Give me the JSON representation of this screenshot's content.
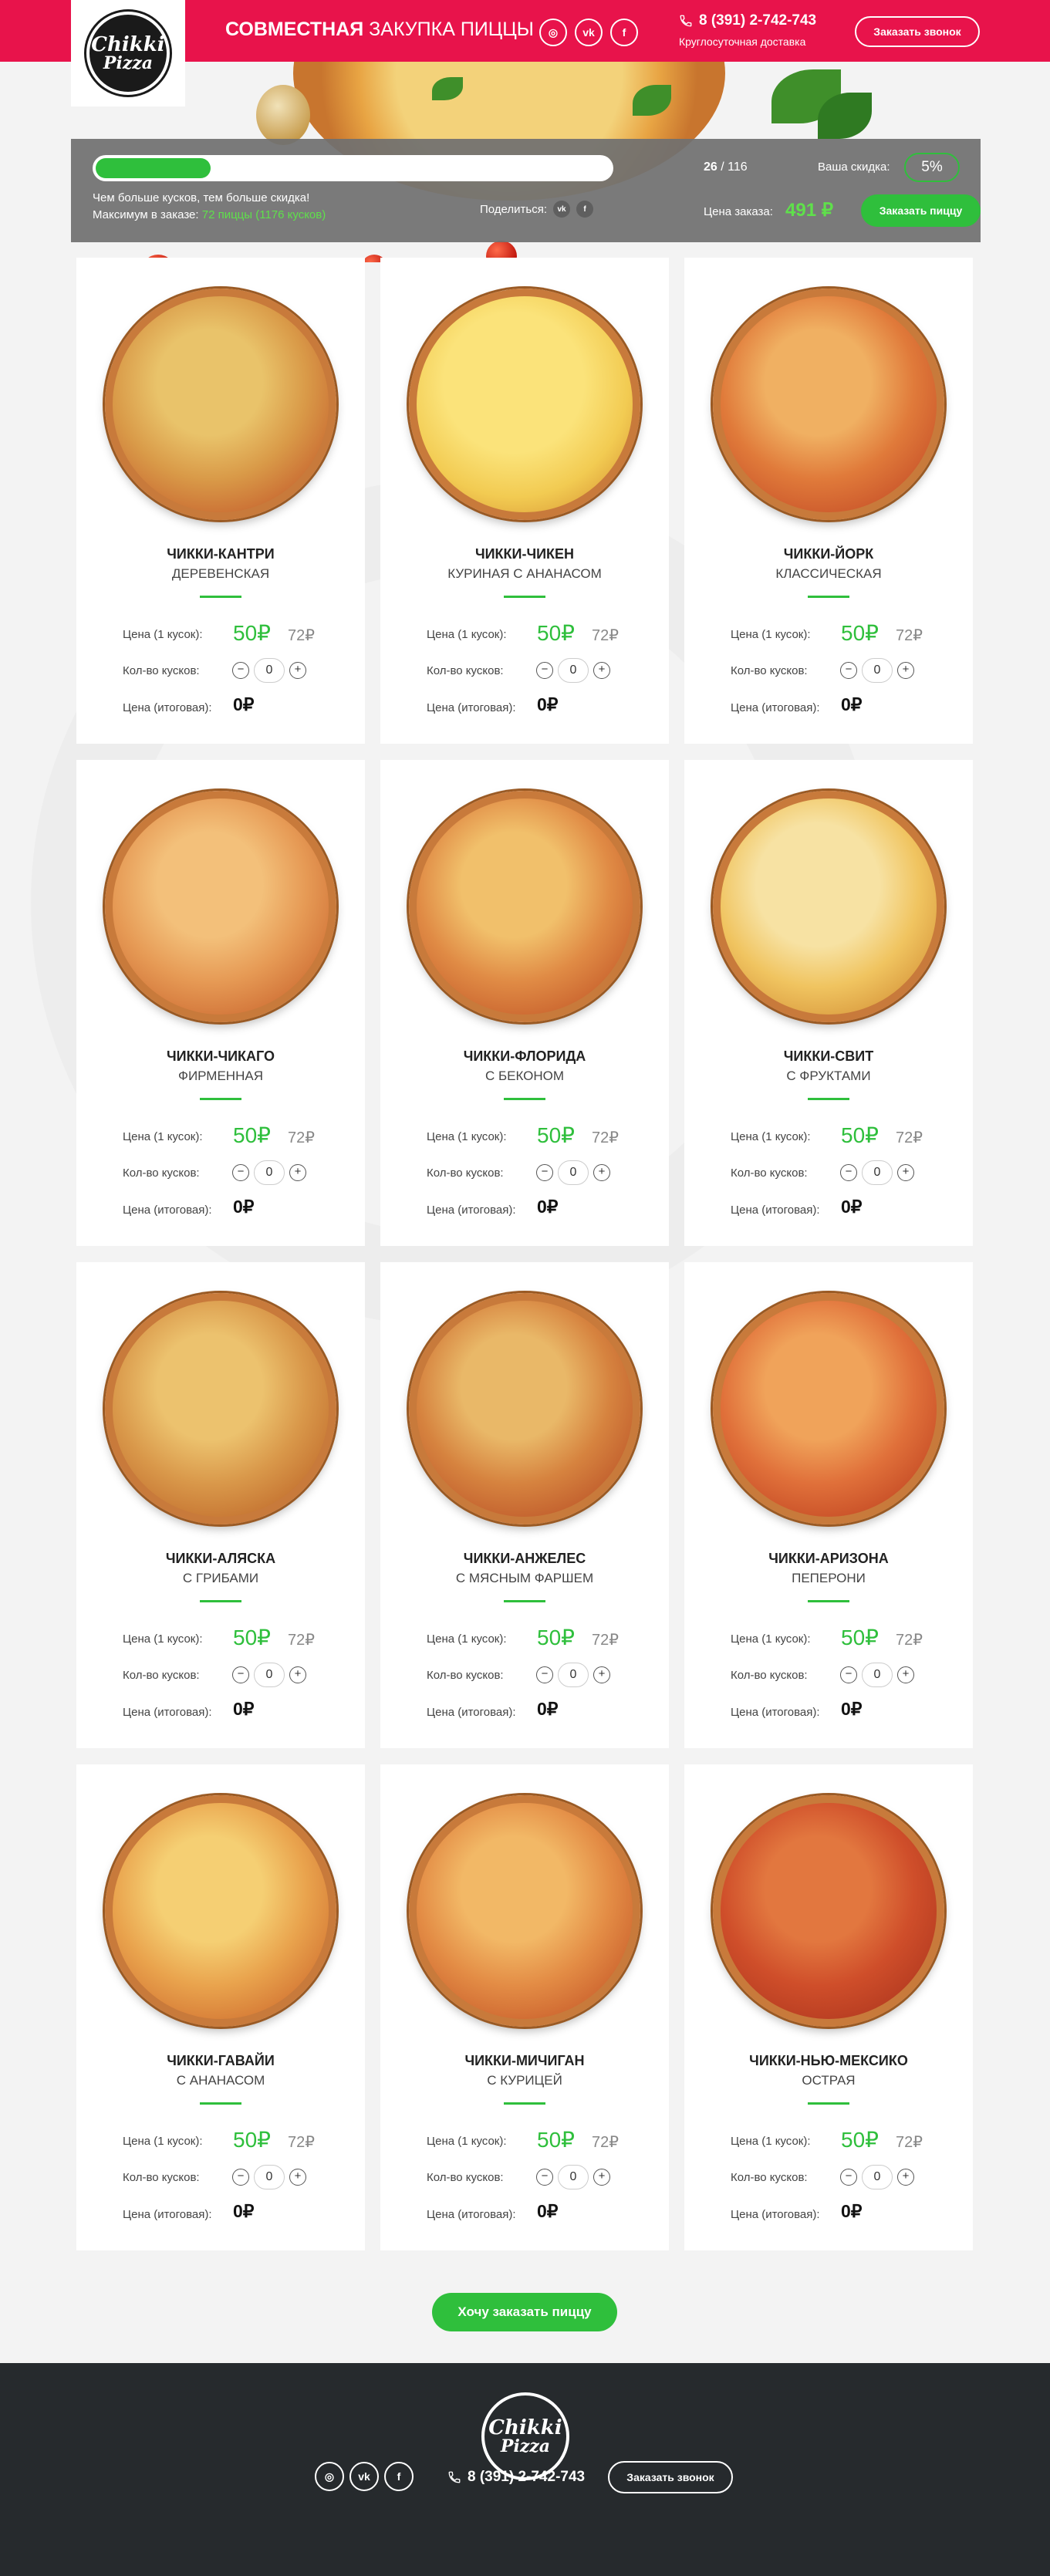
{
  "header": {
    "logo_line1": "Chikki",
    "logo_line2": "Pizza",
    "title_bold": "СОВМЕСТНАЯ",
    "title_rest": "ЗАКУПКА ПИЦЦЫ",
    "phone": "8 (391) 2-742-743",
    "delivery_text": "Круглосуточная доставка",
    "call_button": "Заказать звонок",
    "social": [
      "instagram-icon",
      "vk-icon",
      "facebook-icon"
    ],
    "social_glyphs": {
      "instagram": "◎",
      "vk": "vk",
      "facebook": "f"
    }
  },
  "promo": {
    "progress_fraction": 0.224,
    "text_line1": "Чем больше кусков, тем больше скидка!",
    "text_line2_prefix": "Максимум в заказе:",
    "text_line2_value": "72 пиццы (1176 кусков)",
    "share_label": "Поделиться:",
    "count_current": "26",
    "count_separator": " / ",
    "count_total": "116",
    "discount_label": "Ваша скидка:",
    "discount_value": "5%",
    "total_label": "Цена заказа:",
    "total_value": "491 ₽",
    "order_button": "Заказать пиццу"
  },
  "labels": {
    "price_piece": "Цена (1 кусок):",
    "quantity": "Кол-во кусков:",
    "final_price": "Цена (итоговая):",
    "minus": "−",
    "plus": "+"
  },
  "colors": {
    "brand_red": "#e8134b",
    "accent_green": "#2fbf3c",
    "footer_dark": "#262a2d"
  },
  "pizzas": [
    {
      "name": "ЧИККИ-КАНТРИ",
      "subtitle": "ДЕРЕВЕНСКАЯ",
      "price": "50₽",
      "old_price": "72₽",
      "quantity": "0",
      "final": "0₽"
    },
    {
      "name": "ЧИККИ-ЧИКЕН",
      "subtitle": "КУРИНАЯ С АНАНАСОМ",
      "price": "50₽",
      "old_price": "72₽",
      "quantity": "0",
      "final": "0₽"
    },
    {
      "name": "ЧИККИ-ЙОРК",
      "subtitle": "КЛАССИЧЕСКАЯ",
      "price": "50₽",
      "old_price": "72₽",
      "quantity": "0",
      "final": "0₽"
    },
    {
      "name": "ЧИККИ-ЧИКАГО",
      "subtitle": "ФИРМЕННАЯ",
      "price": "50₽",
      "old_price": "72₽",
      "quantity": "0",
      "final": "0₽"
    },
    {
      "name": "ЧИККИ-ФЛОРИДА",
      "subtitle": "С БЕКОНОМ",
      "price": "50₽",
      "old_price": "72₽",
      "quantity": "0",
      "final": "0₽"
    },
    {
      "name": "ЧИККИ-СВИТ",
      "subtitle": "С ФРУКТАМИ",
      "price": "50₽",
      "old_price": "72₽",
      "quantity": "0",
      "final": "0₽"
    },
    {
      "name": "ЧИККИ-АЛЯСКА",
      "subtitle": "С ГРИБАМИ",
      "price": "50₽",
      "old_price": "72₽",
      "quantity": "0",
      "final": "0₽"
    },
    {
      "name": "ЧИККИ-АНЖЕЛЕС",
      "subtitle": "С МЯСНЫМ ФАРШЕМ",
      "price": "50₽",
      "old_price": "72₽",
      "quantity": "0",
      "final": "0₽"
    },
    {
      "name": "ЧИККИ-АРИЗОНА",
      "subtitle": "ПЕПЕРОНИ",
      "price": "50₽",
      "old_price": "72₽",
      "quantity": "0",
      "final": "0₽"
    },
    {
      "name": "ЧИККИ-ГАВАЙИ",
      "subtitle": "С АНАНАСОМ",
      "price": "50₽",
      "old_price": "72₽",
      "quantity": "0",
      "final": "0₽"
    },
    {
      "name": "ЧИККИ-МИЧИГАН",
      "subtitle": "С КУРИЦЕЙ",
      "price": "50₽",
      "old_price": "72₽",
      "quantity": "0",
      "final": "0₽"
    },
    {
      "name": "ЧИККИ-НЬЮ-МЕКСИКО",
      "subtitle": "ОСТРАЯ",
      "price": "50₽",
      "old_price": "72₽",
      "quantity": "0",
      "final": "0₽"
    }
  ],
  "cta": {
    "label": "Хочу заказать пиццу"
  },
  "footer": {
    "logo_line1": "Chikki",
    "logo_line2": "Pizza",
    "phone": "8 (391) 2-742-743",
    "call_button": "Заказать звонок"
  }
}
